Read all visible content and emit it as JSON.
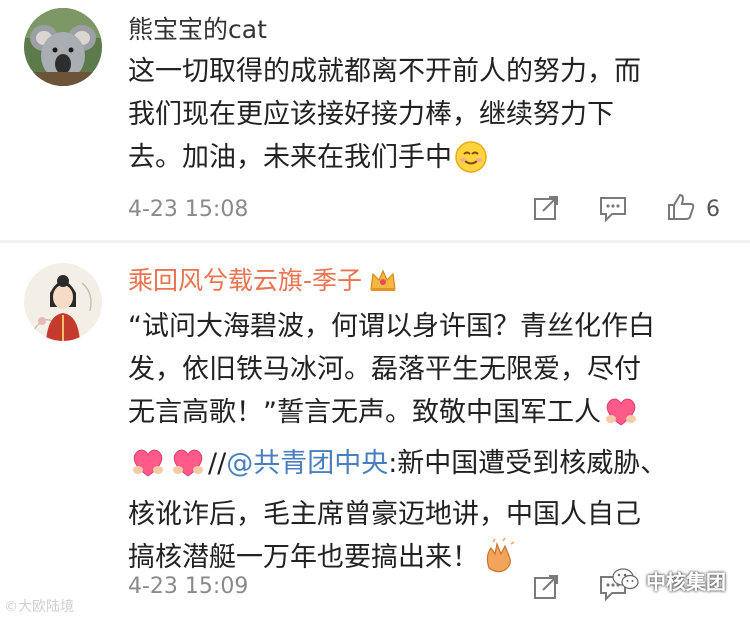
{
  "comments": [
    {
      "username": "熊宝宝的cat",
      "text_lines": [
        "这一切取得的成就都离不开前人的努力，而",
        "我们现在更应该接好接力棒，继续努力下",
        "去。加油，未来在我们手中"
      ],
      "timestamp": "4-23 15:08",
      "like_count": "6",
      "icons": [
        "share-icon",
        "reply-icon",
        "thumbs-up-icon",
        "smile-emoji"
      ]
    },
    {
      "username": "乘回风兮载云旗-季子",
      "text_lines": [
        "“试问大海碧波，何谓以身许国？青丝化作白",
        "发，依旧铁马冰河。磊落平生无限爱，尽付",
        "无言高歌！”誓言无声。致敬中国军工人"
      ],
      "line4_prefix": "//",
      "mention": "@共青团中央",
      "line4_suffix": ":新中国遭受到核威胁、",
      "text_lines_after": [
        "核讹诈后，毛主席曾豪迈地讲，中国人自己",
        "搞核潜艇一万年也要搞出来！"
      ],
      "timestamp": "4-23 15:09",
      "icons": [
        "crown-icon",
        "heart-emoji",
        "clap-emoji",
        "share-icon",
        "reply-icon"
      ]
    }
  ],
  "watermark": {
    "left_text": "©大欧陆境",
    "right_text": "中核集团"
  },
  "colors": {
    "username_highlight": "#eb7350",
    "mention": "#4a7fbf",
    "timestamp": "#8a8a8a",
    "icon": "#7a7a7a"
  }
}
